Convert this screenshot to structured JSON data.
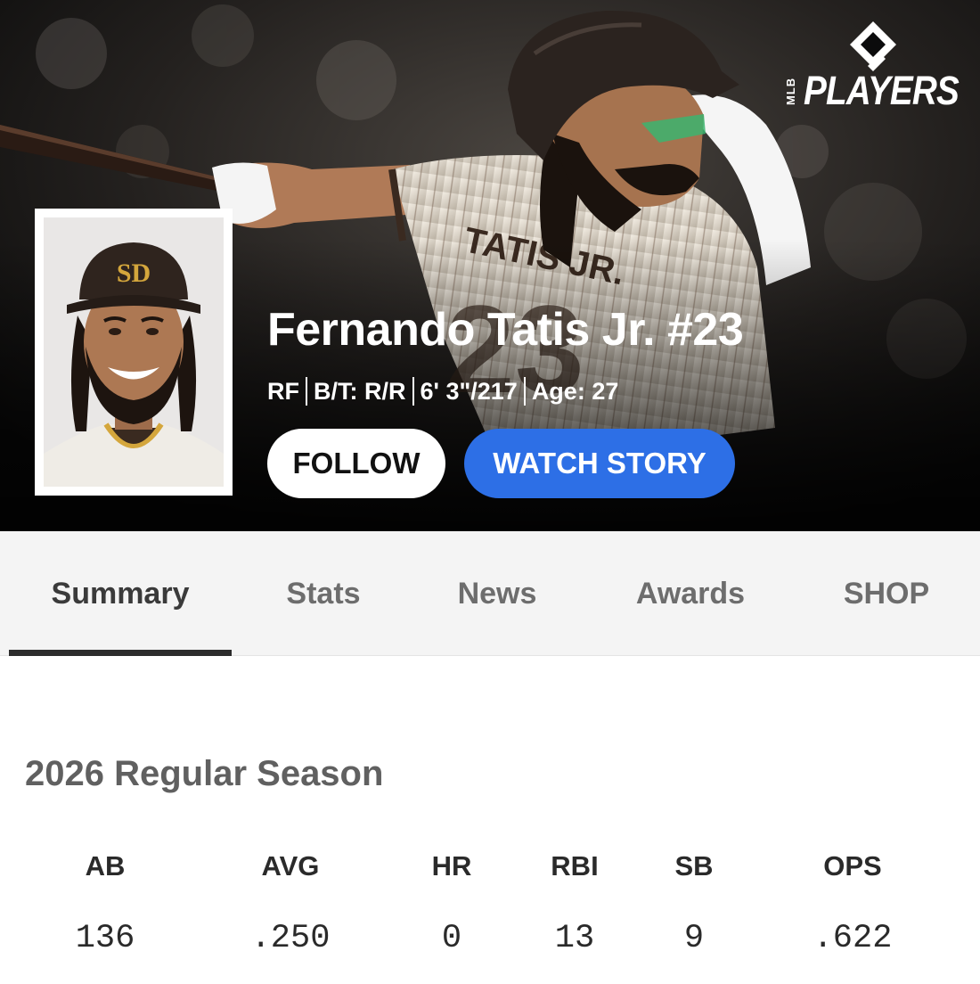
{
  "brand": {
    "logo_small": "MLB",
    "logo_word": "PLAYERS"
  },
  "player": {
    "name": "Fernando Tatis Jr. #23",
    "position": "RF",
    "bats_throws": "B/T: R/R",
    "height_weight": "6' 3\"/217",
    "age": "Age: 27"
  },
  "actions": {
    "follow_label": "FOLLOW",
    "watch_label": "WATCH STORY"
  },
  "tabs": [
    {
      "label": "Summary",
      "active": true
    },
    {
      "label": "Stats",
      "active": false
    },
    {
      "label": "News",
      "active": false
    },
    {
      "label": "Awards",
      "active": false
    },
    {
      "label": "SHOP",
      "active": false
    }
  ],
  "season": {
    "title": "2026 Regular Season",
    "stats": [
      {
        "label": "AB",
        "value": "136"
      },
      {
        "label": "AVG",
        "value": ".250"
      },
      {
        "label": "HR",
        "value": "0"
      },
      {
        "label": "RBI",
        "value": "13"
      },
      {
        "label": "SB",
        "value": "9"
      },
      {
        "label": "OPS",
        "value": ".622"
      }
    ]
  },
  "colors": {
    "hero_bg": "#0b0b0c",
    "accent_blue": "#2d6fe6",
    "tab_bar_bg": "#f4f4f4",
    "padres_brown": "#3a2a20",
    "padres_gold": "#d4a63c"
  }
}
